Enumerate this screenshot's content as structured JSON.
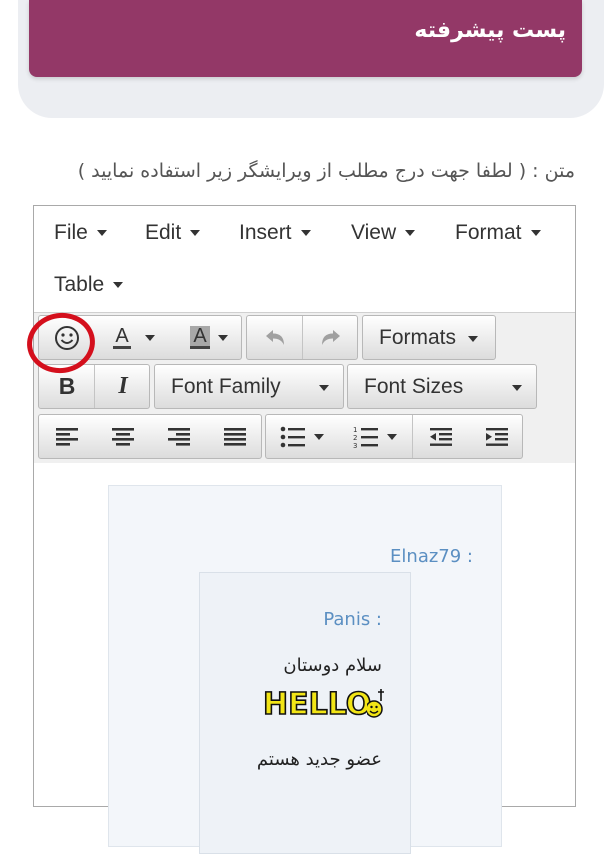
{
  "header": {
    "title": "پست پیشرفته"
  },
  "form": {
    "label": "متن : ( لطفا جهت درج مطلب از ویرایشگر زیر استفاده نمایید )"
  },
  "menubar": {
    "items": [
      {
        "label": "File"
      },
      {
        "label": "Edit"
      },
      {
        "label": "Insert"
      },
      {
        "label": "View"
      },
      {
        "label": "Format"
      },
      {
        "label": "Table"
      }
    ]
  },
  "toolbar": {
    "text_color_letter": "A",
    "bg_color_letter": "A",
    "formats_label": "Formats",
    "bold_label": "B",
    "italic_label": "I",
    "font_family_label": "Font Family",
    "font_sizes_label": "Font Sizes"
  },
  "content": {
    "outer_author": ": Elnaz79",
    "inner_author": ": Panis",
    "greeting": "سلام دوستان",
    "sticker_text": "HELLO",
    "line2": "عضو جدید هستم"
  },
  "colors": {
    "header_bg": "#933867",
    "annotation": "#d40f1c",
    "author_link": "#5b8fc2"
  }
}
